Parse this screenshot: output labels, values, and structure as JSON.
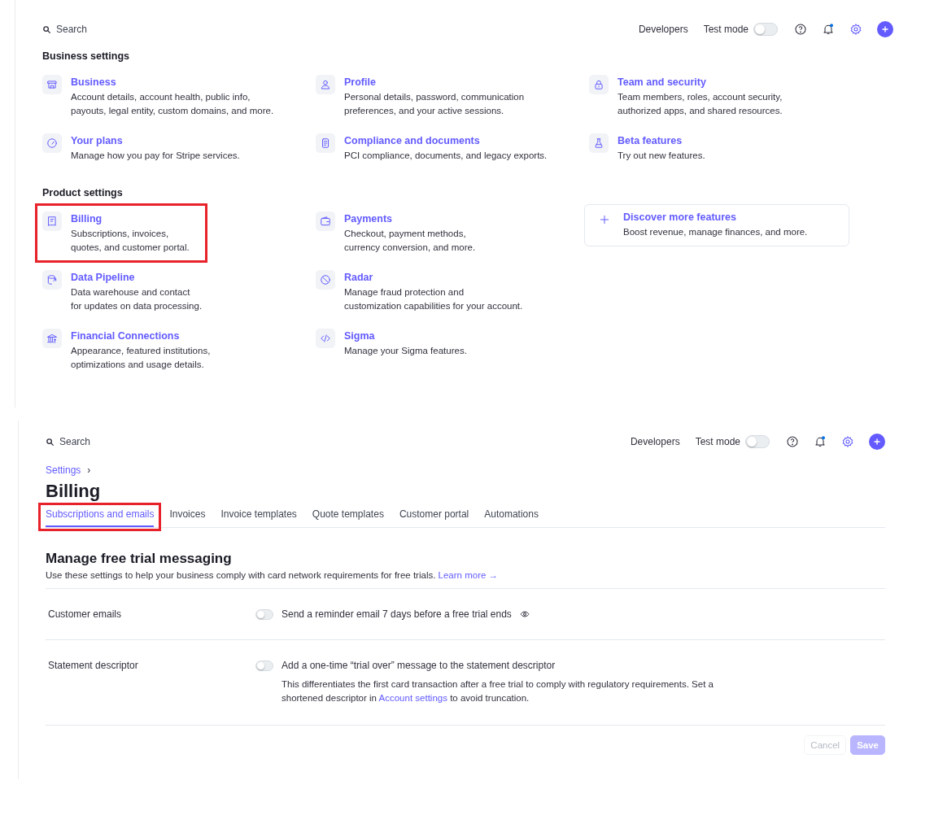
{
  "screens": [
    {
      "kind": "settings_overview",
      "topbar": {
        "search": {
          "placeholder": "Search"
        },
        "developers": "Developers",
        "test_mode": {
          "label": "Test mode",
          "on": false
        },
        "notification_dot": true
      },
      "sections": [
        {
          "title": "Business settings",
          "items": [
            {
              "title": "Business",
              "description": "Account details, account health, public info,\npayouts, legal entity, custom domains, and more.",
              "highlighted": false
            },
            {
              "title": "Profile",
              "description": "Personal details, password, communication\npreferences, and your active sessions.",
              "highlighted": false
            },
            {
              "title": "Team and security",
              "description": "Team members, roles, account security,\nauthorized apps, and shared resources.",
              "highlighted": false
            },
            {
              "title": "Your plans",
              "description": "Manage how you pay for Stripe services.",
              "highlighted": false
            },
            {
              "title": "Compliance and documents",
              "description": "PCI compliance, documents, and legacy exports.",
              "highlighted": false
            },
            {
              "title": "Beta features",
              "description": "Try out new features.",
              "highlighted": false
            }
          ]
        },
        {
          "title": "Product settings",
          "items": [
            {
              "title": "Billing",
              "description": "Subscriptions, invoices,\nquotes, and customer portal.",
              "highlighted": true
            },
            {
              "title": "Payments",
              "description": "Checkout, payment methods,\ncurrency conversion, and more.",
              "highlighted": false
            },
            {
              "kind": "card",
              "title": "Discover more features",
              "description": "Boost revenue, manage finances, and more.",
              "highlighted": false
            },
            {
              "title": "Data Pipeline",
              "description": "Data warehouse and contact\nfor updates on data processing.",
              "highlighted": false
            },
            {
              "title": "Radar",
              "description": "Manage fraud protection and\ncustomization capabilities for your account.",
              "highlighted": false
            },
            {
              "title": "Financial Connections",
              "description": "Appearance, featured institutions,\noptimizations and usage details.",
              "highlighted": false
            },
            {
              "title": "Sigma",
              "description": "Manage your Sigma features.",
              "highlighted": false
            }
          ]
        }
      ]
    },
    {
      "kind": "billing",
      "topbar": {
        "search": {
          "placeholder": "Search"
        },
        "developers": "Developers",
        "test_mode": {
          "label": "Test mode",
          "on": false
        },
        "notification_dot": true
      },
      "breadcrumb": [
        "Settings",
        "›"
      ],
      "title": "Billing",
      "tabs": [
        {
          "label": "Subscriptions and emails",
          "selected": true,
          "highlighted": true
        },
        {
          "label": "Invoices",
          "selected": false,
          "highlighted": false
        },
        {
          "label": "Invoice templates",
          "selected": false,
          "highlighted": false
        },
        {
          "label": "Quote templates",
          "selected": false,
          "highlighted": false
        },
        {
          "label": "Customer portal",
          "selected": false,
          "highlighted": false
        },
        {
          "label": "Automations",
          "selected": false,
          "highlighted": false
        }
      ],
      "section": {
        "title": "Manage free trial messaging",
        "description": "Use these settings to help your business comply with card network requirements for free trials.",
        "link": "Learn more →",
        "rows": [
          {
            "label": "Customer emails",
            "on": false,
            "option": "Send a reminder email 7 days before a free trial ends",
            "preview_icon": true
          },
          {
            "label": "Statement descriptor",
            "on": false,
            "option": "Add a one-time “trial over” message to the statement descriptor",
            "help_before": "This differentiates the first card transaction after a free trial to comply with regulatory requirements. Set a\nshortened descriptor in",
            "help_link": "Account settings",
            "help_after": "to avoid truncation."
          }
        ]
      },
      "buttons": [
        {
          "label": "Cancel",
          "kind": "secondary",
          "disabled": true
        },
        {
          "label": "Save",
          "kind": "primary",
          "disabled": true
        }
      ]
    }
  ]
}
